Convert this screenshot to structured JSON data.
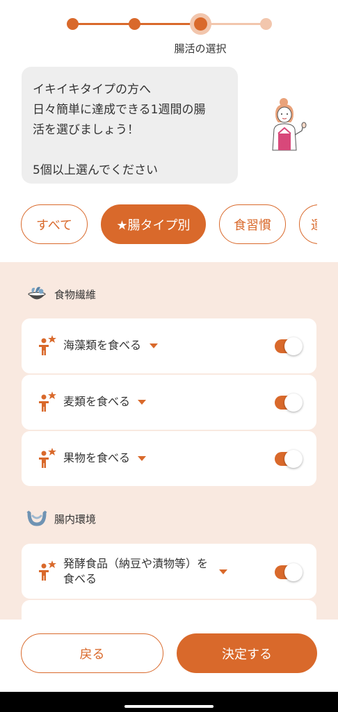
{
  "progress": {
    "step_label": "腸活の選択",
    "current_step": 3,
    "total_steps": 4,
    "accent_color": "#d9692b",
    "inactive_color": "#f2c6ad"
  },
  "message": {
    "line1": "イキイキタイプの方へ",
    "line2": "日々簡単に達成できる1週間の腸",
    "line3": "活を選びましょう！",
    "line4": "5個以上選んでください"
  },
  "tabs": [
    {
      "label": "すべて",
      "active": false
    },
    {
      "label": "★腸タイプ別",
      "active": true
    },
    {
      "label": "食習慣",
      "active": false
    },
    {
      "label": "運",
      "active": false
    }
  ],
  "sections": [
    {
      "title": "食物繊維",
      "icon": "salad-bowl-icon",
      "items": [
        {
          "label": "海藻類を食べる",
          "enabled": true
        },
        {
          "label": "麦類を食べる",
          "enabled": true
        },
        {
          "label": "果物を食べる",
          "enabled": true
        }
      ]
    },
    {
      "title": "腸内環境",
      "icon": "intestine-icon",
      "items": [
        {
          "label_line1": "発酵食品（納豆や漬物等）を",
          "label_line2": "食べる",
          "enabled": true
        }
      ]
    }
  ],
  "buttons": {
    "back": "戻る",
    "confirm": "決定する"
  }
}
